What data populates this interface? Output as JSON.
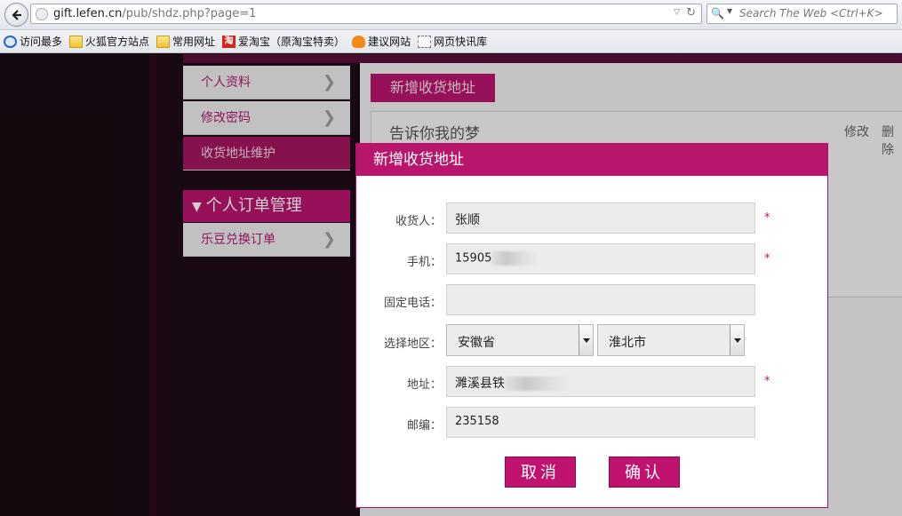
{
  "browser": {
    "url_domain": "gift.lefen.cn",
    "url_path": "/pub/shdz.php?page=1",
    "search_placeholder": "Search The Web <Ctrl+K>",
    "bookmarks": [
      {
        "label": "访问最多",
        "icon": "history-icon"
      },
      {
        "label": "火狐官方站点",
        "icon": "folder-icon"
      },
      {
        "label": "常用网址",
        "icon": "folder-icon"
      },
      {
        "label": "爱淘宝（原淘宝特卖）",
        "icon": "taobao-icon"
      },
      {
        "label": "建议网站",
        "icon": "bulb-icon"
      },
      {
        "label": "网页快讯库",
        "icon": "web-slice-icon"
      }
    ]
  },
  "sidebar": {
    "items": [
      {
        "label": "个人资料"
      },
      {
        "label": "修改密码"
      },
      {
        "label": "收货地址维护"
      }
    ],
    "section_title": "个人订单管理",
    "order_items": [
      {
        "label": "乐豆兑换订单"
      }
    ]
  },
  "main": {
    "add_address_label": "新增收货地址",
    "card": {
      "title": "告诉你我的梦",
      "edit_label": "修改",
      "delete_label": "删除"
    }
  },
  "modal": {
    "title": "新增收货地址",
    "fields": {
      "receiver": {
        "label": "收货人：",
        "value": "张顺"
      },
      "mobile": {
        "label": "手机：",
        "value": "15905"
      },
      "phone": {
        "label": "固定电话：",
        "value": ""
      },
      "region": {
        "label": "选择地区：",
        "province": "安徽省",
        "city": "淮北市"
      },
      "address": {
        "label": "地址：",
        "value": "濉溪县铁"
      },
      "zip": {
        "label": "邮编：",
        "value": "235158"
      }
    },
    "required_mark": "*",
    "cancel_label": "取消",
    "confirm_label": "确认"
  },
  "colors": {
    "brand": "#b8156d",
    "page_dark": "#170c14"
  }
}
